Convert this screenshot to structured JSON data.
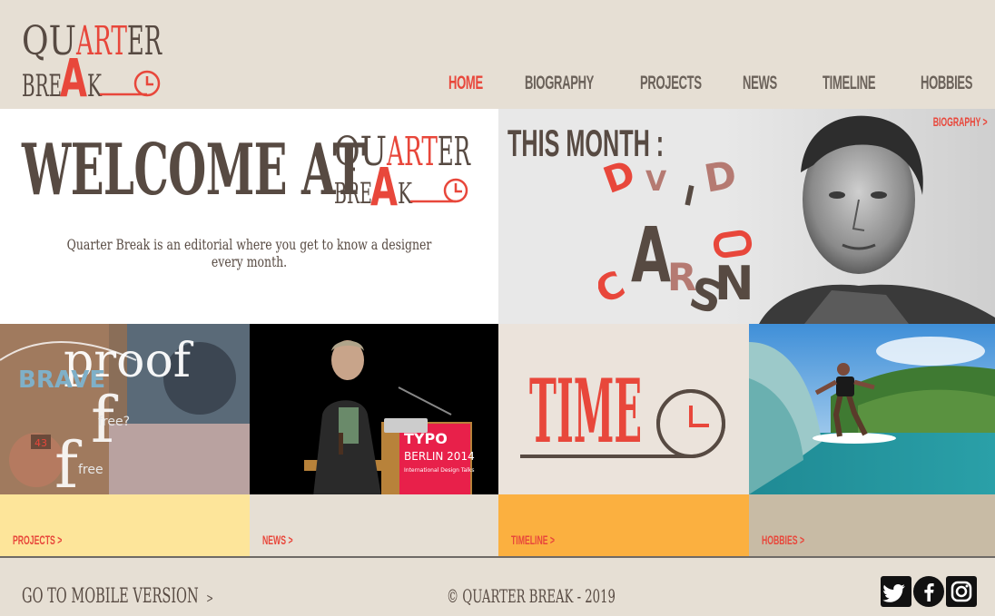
{
  "brand": {
    "logo_line1": "QUARTER",
    "logo_line2": "BREAK",
    "accent": "#e8473b",
    "dark": "#574a42"
  },
  "nav": {
    "items": [
      {
        "label": "HOME",
        "active": true
      },
      {
        "label": "BIOGRAPHY",
        "active": false
      },
      {
        "label": "PROJECTS",
        "active": false
      },
      {
        "label": "NEWS",
        "active": false
      },
      {
        "label": "TIMELINE",
        "active": false
      },
      {
        "label": "HOBBIES",
        "active": false
      }
    ]
  },
  "welcome": {
    "title": "WELCOME AT",
    "text": "Quarter Break is an editorial where you get to know a designer every month."
  },
  "month": {
    "label": "THIS MONTH :",
    "designer_first": "DAVID",
    "designer_last": "CARSON",
    "link": "BIOGRAPHY >"
  },
  "tiles": [
    {
      "link": "PROJECTS >",
      "bg": "#fde59a",
      "image_words": [
        "proof",
        "free",
        "free?",
        "free",
        "43"
      ]
    },
    {
      "link": "NEWS >",
      "bg": "#e6dfd4",
      "image_words": [
        "TYPO",
        "BERLIN 2014",
        "International Design Talks"
      ]
    },
    {
      "link": "TIMELINE >",
      "bg": "#fbb040",
      "image_words": [
        "TIME"
      ]
    },
    {
      "link": "HOBBIES >",
      "bg": "#c8bba5",
      "image_words": []
    }
  ],
  "footer": {
    "mobile_link": "GO TO MOBILE VERSION",
    "mobile_arrow": ">",
    "copyright": "© QUARTER BREAK - 2019",
    "social_icons": [
      "twitter-icon",
      "facebook-icon",
      "instagram-icon"
    ]
  }
}
